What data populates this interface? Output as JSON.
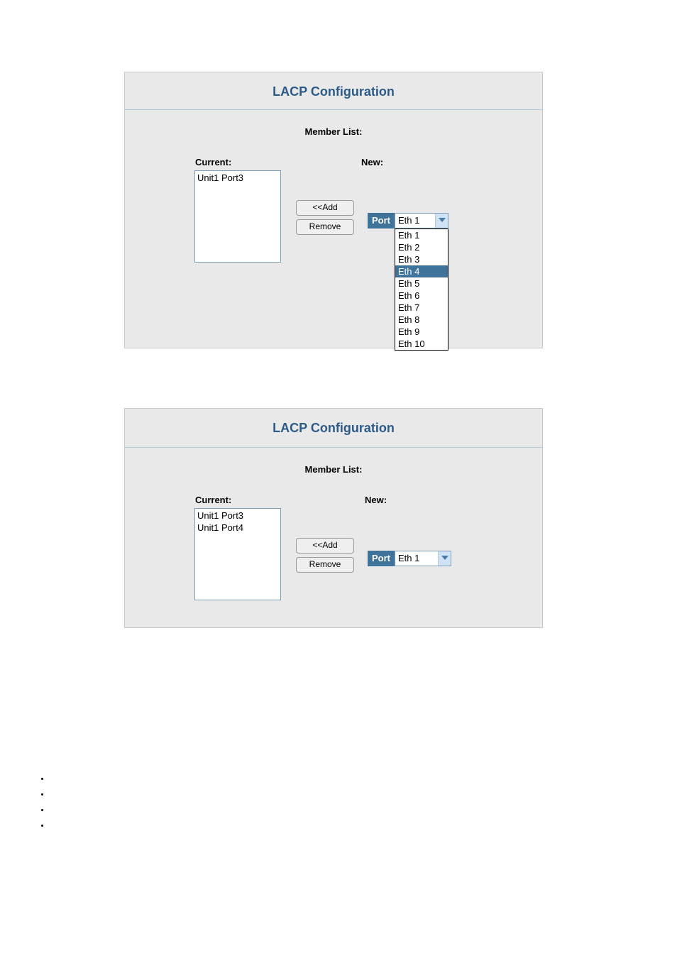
{
  "panel1": {
    "title": "LACP Configuration",
    "subtitle": "Member List:",
    "currentLabel": "Current:",
    "newLabel": "New:",
    "currentItems": [
      "Unit1 Port3"
    ],
    "addLabel": "<<Add",
    "removeLabel": "Remove",
    "portLabel": "Port",
    "portSelected": "Eth 1",
    "portOptions": [
      "Eth 1",
      "Eth 2",
      "Eth 3",
      "Eth 4",
      "Eth 5",
      "Eth 6",
      "Eth 7",
      "Eth 8",
      "Eth 9",
      "Eth 10"
    ],
    "portHighlighted": "Eth 4"
  },
  "panel2": {
    "title": "LACP Configuration",
    "subtitle": "Member List:",
    "currentLabel": "Current:",
    "newLabel": "New:",
    "currentItems": [
      "Unit1 Port3",
      "Unit1 Port4"
    ],
    "addLabel": "<<Add",
    "removeLabel": "Remove",
    "portLabel": "Port",
    "portSelected": "Eth 1"
  }
}
